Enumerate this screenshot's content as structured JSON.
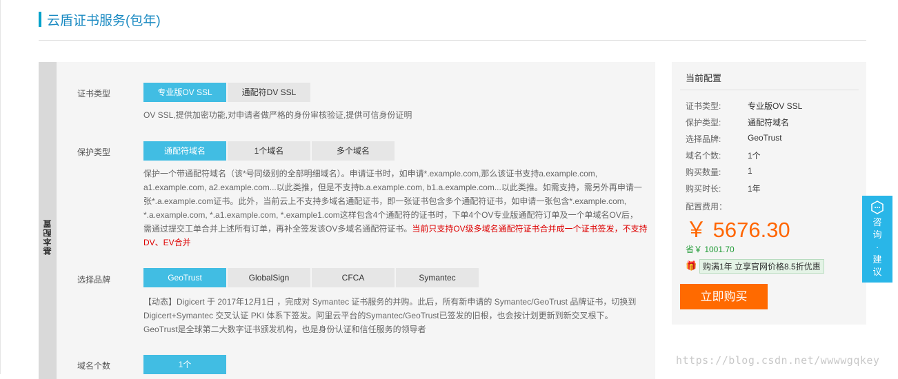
{
  "page": {
    "title": "云盾证书服务(包年)"
  },
  "config": {
    "side_label": "基本配置",
    "cert_type": {
      "label": "证书类型",
      "options": [
        "专业版OV SSL",
        "通配符DV SSL"
      ],
      "selected": "专业版OV SSL",
      "desc": "OV SSL,提供加密功能,对申请者做严格的身份审核验证,提供可信身份证明"
    },
    "protect_type": {
      "label": "保护类型",
      "options": [
        "通配符域名",
        "1个域名",
        "多个域名"
      ],
      "selected": "通配符域名",
      "desc_lines": [
        "保护一个带通配符域名（该*号同级别的全部明细域名）。申请证书时，如申请*.example.com,那么该证书支持a.example.com,",
        "a1.example.com, a2.example.com...以此类推，但是不支持b.a.example.com, b1.a.example.com...以此类推。如需支持，需另外再申请一",
        "张*.a.example.com证书。此外，当前云上不支持多域名通配证书，即一张证书包含多个通配符证书，如申请一张包含*.example.com,",
        "*.a.example.com, *.a1.example.com, *.example1.com这样包含4个通配符的证书时，下单4个OV专业版通配符订单及一个单域名OV后，",
        "需通过提交工单合并上述所有订单，再补全签发该OV多域名通配符证书。"
      ],
      "warn_lines": [
        "当前只支持OV级多域名通配符证书合并成一个证书签发，不支持",
        "DV、EV合并"
      ]
    },
    "brand": {
      "label": "选择品牌",
      "options": [
        "GeoTrust",
        "GlobalSign",
        "CFCA",
        "Symantec"
      ],
      "selected": "GeoTrust",
      "desc_lines": [
        "【动态】Digicert 于 2017年12月1日 ，完成对 Symantec 证书服务的并购。此后，所有新申请的 Symantec/GeoTrust 品牌证书，切换到",
        "Digicert+Symantec 交叉认证 PKI 体系下签发。阿里云平台的Symantec/GeoTrust已签发的旧根，也会按计划更新到新交叉根下。",
        "GeoTrust是全球第二大数字证书颁发机构，也是身份认证和信任服务的领导者"
      ]
    },
    "domain_count": {
      "label": "域名个数",
      "options": [
        "1个"
      ],
      "selected": "1个"
    }
  },
  "summary": {
    "title": "当前配置",
    "rows": [
      {
        "label": "证书类型:",
        "value": "专业版OV SSL"
      },
      {
        "label": "保护类型:",
        "value": "通配符域名"
      },
      {
        "label": "选择品牌:",
        "value": "GeoTrust"
      },
      {
        "label": "域名个数:",
        "value": "1个"
      },
      {
        "label": "购买数量:",
        "value": "1"
      },
      {
        "label": "购买时长:",
        "value": "1年"
      }
    ],
    "fee_label": "配置费用：",
    "price": "￥ 5676.30",
    "saving": "省￥ 1001.70",
    "promo_icon": "gift-icon",
    "promo": "购满1年 立享官网价格8.5折优惠",
    "buy_label": "立即购买"
  },
  "consult": {
    "icon": "chat-icon",
    "chars": [
      "咨",
      "询",
      "·",
      "建",
      "议"
    ]
  },
  "watermark": "https://blog.csdn.net/wwwwgqkey",
  "colors": {
    "accent": "#41bde3",
    "title": "#1a8ac2",
    "price": "#ff6600",
    "buy": "#ff6a00",
    "saving": "#1f9a35",
    "warn": "#dd0000"
  }
}
